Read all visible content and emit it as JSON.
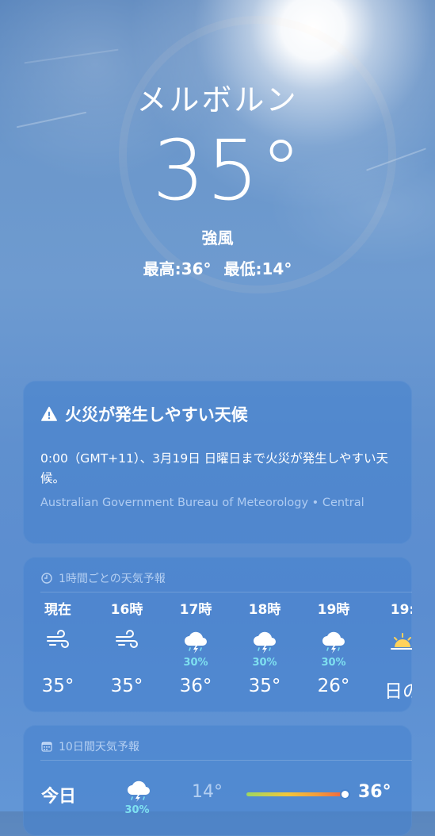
{
  "location": {
    "city": "メルボルン",
    "temperature": "35°",
    "condition": "強風",
    "high": "最高:36°",
    "low": "最低:14°"
  },
  "alert": {
    "title": "火災が発生しやすい天候",
    "body": "0:00（GMT+11）、3月19日 日曜日まで火災が発生しやすい天候。",
    "source": "Australian Government Bureau of Meteorology • Central"
  },
  "hourly": {
    "title": "1時間ごとの天気予報",
    "hours": [
      {
        "label": "現在",
        "icon": "wind-icon",
        "pop": "",
        "temp": "35°"
      },
      {
        "label": "16時",
        "icon": "wind-icon",
        "pop": "",
        "temp": "35°"
      },
      {
        "label": "17時",
        "icon": "thunderstorm-icon",
        "pop": "30%",
        "temp": "36°"
      },
      {
        "label": "18時",
        "icon": "thunderstorm-icon",
        "pop": "30%",
        "temp": "35°"
      },
      {
        "label": "19時",
        "icon": "thunderstorm-icon",
        "pop": "30%",
        "temp": "26°"
      },
      {
        "label": "19:",
        "icon": "sunset-icon",
        "pop": "",
        "temp": "日の"
      }
    ]
  },
  "daily": {
    "title": "10日間天気予報",
    "days": [
      {
        "name": "今日",
        "icon": "thunderstorm-icon",
        "pop": "30%",
        "low": "14°",
        "high": "36°"
      }
    ]
  },
  "colors": {
    "accent_pop": "#7ee0f0",
    "card": "#4682cd",
    "temp_bar_start": "#9ed760",
    "temp_bar_end": "#ef5b3f"
  }
}
